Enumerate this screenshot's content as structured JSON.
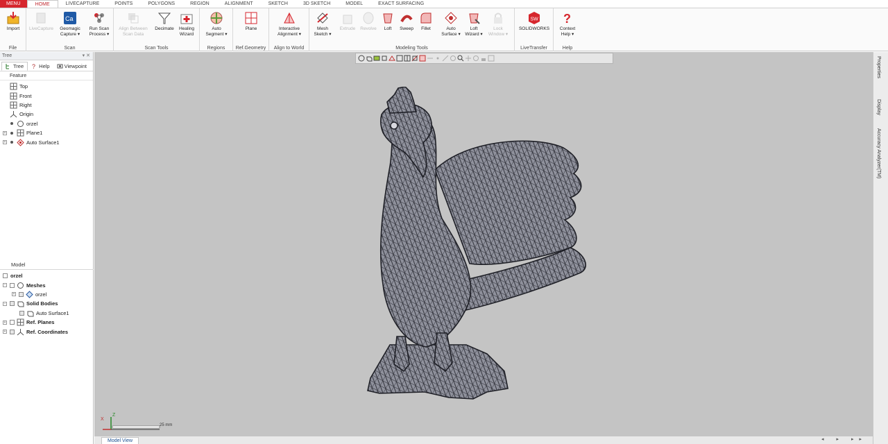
{
  "tabs": [
    {
      "label": "MENU",
      "kind": "menu"
    },
    {
      "label": "HOME",
      "kind": "active"
    },
    {
      "label": "LIVECAPTURE",
      "kind": ""
    },
    {
      "label": "POINTS",
      "kind": ""
    },
    {
      "label": "POLYGONS",
      "kind": ""
    },
    {
      "label": "REGION",
      "kind": ""
    },
    {
      "label": "ALIGNMENT",
      "kind": ""
    },
    {
      "label": "SKETCH",
      "kind": ""
    },
    {
      "label": "3D SKETCH",
      "kind": ""
    },
    {
      "label": "MODEL",
      "kind": ""
    },
    {
      "label": "EXACT SURFACING",
      "kind": ""
    }
  ],
  "ribbon": {
    "groups": {
      "file": "File",
      "scan": "Scan",
      "scan_tools": "Scan Tools",
      "regions": "Regions",
      "ref_geometry": "Ref.Geometry",
      "align_to_world": "Align to World",
      "modeling_tools": "Modeling Tools",
      "live_transfer": "LiveTransfer",
      "help": "Help"
    },
    "buttons": {
      "import": "Import",
      "livecapture": "LiveCapture",
      "geomagic_capture": "Geomagic\nCapture ▾",
      "run_scan_process": "Run Scan\nProcess ▾",
      "align_between_scan_data": "Align Between\nScan Data",
      "decimate": "Decimate",
      "healing_wizard": "Healing\nWizard",
      "auto_segment": "Auto\nSegment ▾",
      "plane": "Plane",
      "interactive_alignment": "Interactive\nAlignment ▾",
      "mesh_sketch": "Mesh\nSketch ▾",
      "extrude": "Extrude",
      "revolve": "Revolve",
      "loft": "Loft",
      "sweep": "Sweep",
      "fillet": "Fillet",
      "auto_surface": "Auto\nSurface ▾",
      "loft_wizard": "Loft\nWizard ▾",
      "lock_window": "Lock\nWindow ▾",
      "solidworks": "SOLIDWORKS",
      "context_help": "Context\nHelp ▾"
    }
  },
  "panel": {
    "title": "Tree",
    "pin": "▾ ✕",
    "tabs": [
      "Tree",
      "Help",
      "Viewpoint"
    ],
    "column_header": "Feature",
    "feature_tree": [
      "Top",
      "Front",
      "Right",
      "Origin",
      "orzel",
      "Plane1",
      "Auto Surface1"
    ],
    "model_label": "Model",
    "model_tree": [
      "orzel",
      "Meshes",
      "orzel",
      "Solid Bodies",
      "Auto Surface1",
      "Ref. Planes",
      "Ref. Coordinates"
    ]
  },
  "viewport": {
    "scale_label": "25 mm",
    "axis_z": "Z",
    "axis_x": "X"
  },
  "right_tabs": [
    "Properties",
    "Display",
    "Accuracy Analyzer(TM)"
  ],
  "status": {
    "tab": "Model View",
    "arrows": "◂ ▸ ▸▸"
  },
  "colors": {
    "accent": "#d6262d",
    "viewport_bg": "#c4c4c4",
    "mesh": "#3c3e48"
  }
}
